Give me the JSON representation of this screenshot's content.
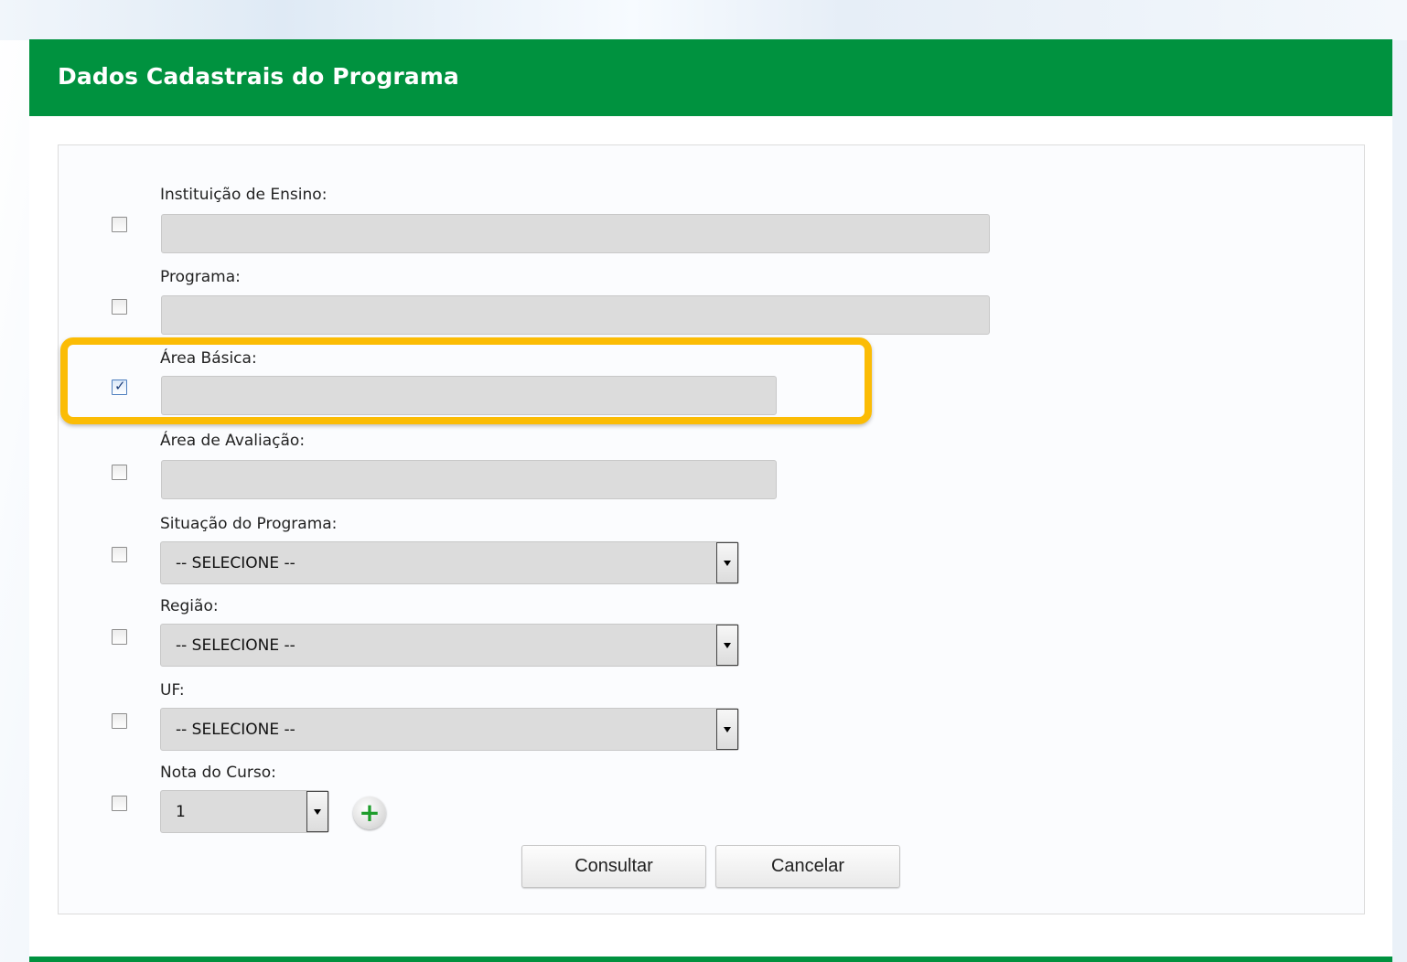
{
  "panel": {
    "title": "Dados Cadastrais do Programa"
  },
  "form": {
    "fields": [
      {
        "label": "Instituição de Ensino:",
        "checked": false,
        "type": "text",
        "value": ""
      },
      {
        "label": "Programa:",
        "checked": false,
        "type": "text",
        "value": ""
      },
      {
        "label": "Área Básica:",
        "checked": true,
        "type": "text",
        "value": "",
        "highlighted": true
      },
      {
        "label": "Área de Avaliação:",
        "checked": false,
        "type": "text",
        "value": ""
      },
      {
        "label": "Situação do Programa:",
        "checked": false,
        "type": "select",
        "value": "-- SELECIONE --"
      },
      {
        "label": "Região:",
        "checked": false,
        "type": "select",
        "value": "-- SELECIONE --"
      },
      {
        "label": "UF:",
        "checked": false,
        "type": "select",
        "value": "-- SELECIONE --"
      },
      {
        "label": "Nota do Curso:",
        "checked": false,
        "type": "select",
        "value": "1"
      }
    ],
    "checkmark_glyph": "✓",
    "add_glyph": "+",
    "add_icon": "add-icon"
  },
  "actions": {
    "consultar_label": "Consultar",
    "cancelar_label": "Cancelar"
  },
  "colors": {
    "header": "#00923f",
    "highlight": "#fbbc05",
    "field_bg": "#dcdcdc"
  }
}
